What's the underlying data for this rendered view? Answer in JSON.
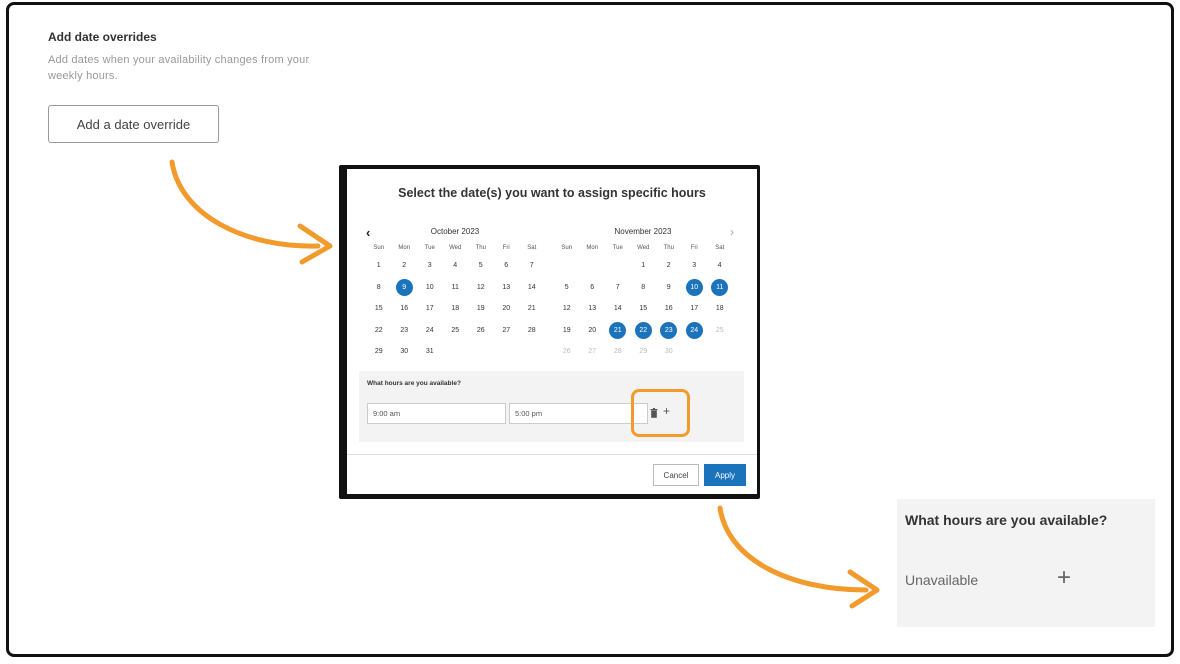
{
  "overrides": {
    "title": "Add date overrides",
    "description": "Add dates when your availability changes from your weekly hours.",
    "button_label": "Add a date override"
  },
  "modal": {
    "title": "Select the date(s) you want to assign specific hours",
    "prev_icon": "chevron-left-icon",
    "next_icon": "chevron-right-icon",
    "weekdays": [
      "Sun",
      "Mon",
      "Tue",
      "Wed",
      "Thu",
      "Fri",
      "Sat"
    ],
    "months": [
      {
        "title": "October 2023",
        "days": [
          {
            "d": "1"
          },
          {
            "d": "2"
          },
          {
            "d": "3"
          },
          {
            "d": "4"
          },
          {
            "d": "5"
          },
          {
            "d": "6"
          },
          {
            "d": "7"
          },
          {
            "d": "8"
          },
          {
            "d": "9",
            "sel": true
          },
          {
            "d": "10"
          },
          {
            "d": "11"
          },
          {
            "d": "12"
          },
          {
            "d": "13"
          },
          {
            "d": "14"
          },
          {
            "d": "15"
          },
          {
            "d": "16"
          },
          {
            "d": "17"
          },
          {
            "d": "18"
          },
          {
            "d": "19"
          },
          {
            "d": "20"
          },
          {
            "d": "21"
          },
          {
            "d": "22"
          },
          {
            "d": "23"
          },
          {
            "d": "24"
          },
          {
            "d": "25"
          },
          {
            "d": "26"
          },
          {
            "d": "27"
          },
          {
            "d": "28"
          },
          {
            "d": "29"
          },
          {
            "d": "30"
          },
          {
            "d": "31"
          }
        ],
        "leading_blanks": 0
      },
      {
        "title": "November 2023",
        "days": [
          {
            "d": "1"
          },
          {
            "d": "2"
          },
          {
            "d": "3"
          },
          {
            "d": "4"
          },
          {
            "d": "5"
          },
          {
            "d": "6"
          },
          {
            "d": "7"
          },
          {
            "d": "8"
          },
          {
            "d": "9"
          },
          {
            "d": "10",
            "sel": true
          },
          {
            "d": "11",
            "sel": true
          },
          {
            "d": "12"
          },
          {
            "d": "13"
          },
          {
            "d": "14"
          },
          {
            "d": "15"
          },
          {
            "d": "16"
          },
          {
            "d": "17"
          },
          {
            "d": "18"
          },
          {
            "d": "19"
          },
          {
            "d": "20"
          },
          {
            "d": "21",
            "sel": true
          },
          {
            "d": "22",
            "sel": true
          },
          {
            "d": "23",
            "sel": true
          },
          {
            "d": "24",
            "sel": true
          },
          {
            "d": "25",
            "muted": true
          },
          {
            "d": "26",
            "muted": true
          },
          {
            "d": "27",
            "muted": true
          },
          {
            "d": "28",
            "muted": true
          },
          {
            "d": "29",
            "muted": true
          },
          {
            "d": "30",
            "muted": true
          }
        ],
        "leading_blanks": 3
      }
    ],
    "hours_label": "What hours are you available?",
    "start_time": "9:00 am",
    "end_time": "5:00 pm",
    "delete_icon": "trash-icon",
    "add_icon": "plus-icon",
    "cancel_label": "Cancel",
    "apply_label": "Apply"
  },
  "right_panel": {
    "title": "What hours are you available?",
    "status": "Unavailable",
    "add_icon": "plus-icon"
  },
  "colors": {
    "accent": "#1b74bb",
    "highlight": "#f39a2c"
  }
}
